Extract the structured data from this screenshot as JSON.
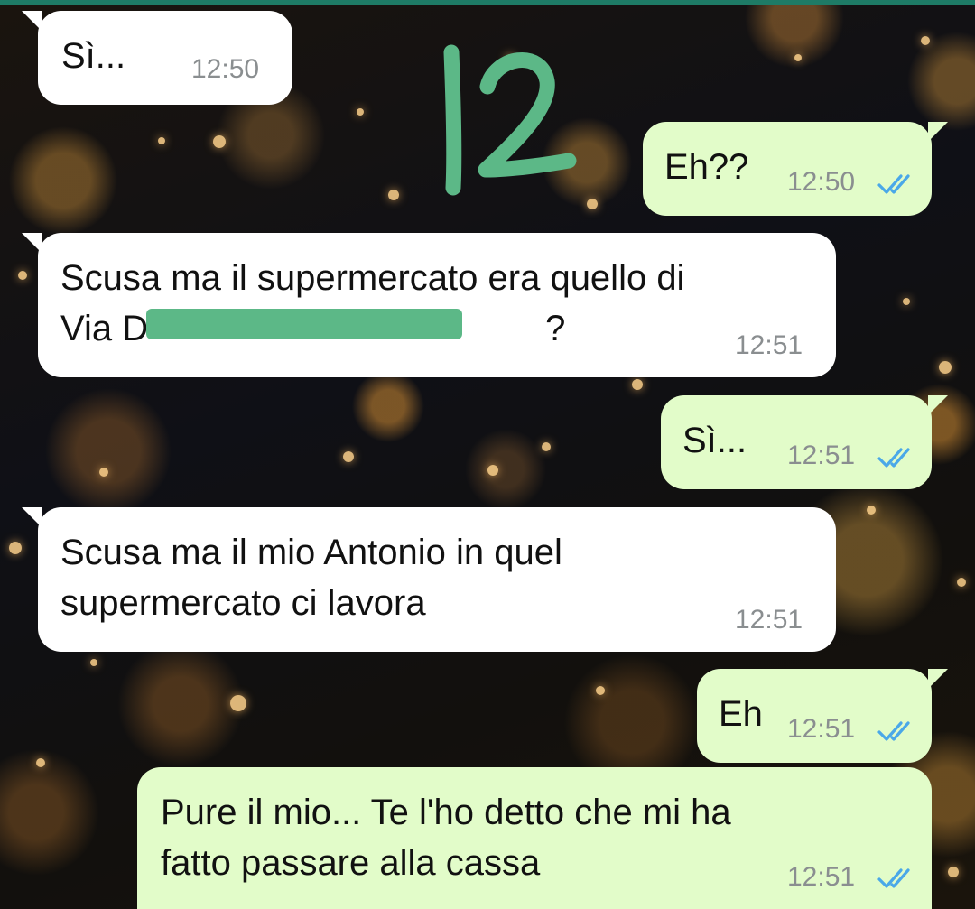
{
  "colors": {
    "incoming_bubble": "#ffffff",
    "outgoing_bubble": "#e2fcc9",
    "read_ticks": "#4aa8e8",
    "timestamp": "#8a8e90",
    "annotation": "#5cb887",
    "header_strip": "#1e7b66"
  },
  "annotation": {
    "label": "12"
  },
  "messages": [
    {
      "direction": "incoming",
      "text": "Sì...",
      "time": "12:50"
    },
    {
      "direction": "outgoing",
      "text": "Eh??",
      "time": "12:50",
      "status_icon": "double-check-read-icon"
    },
    {
      "direction": "incoming",
      "text": "Scusa ma il supermercato era quello di\nVia D           ?",
      "time": "12:51",
      "redacted": true
    },
    {
      "direction": "outgoing",
      "text": "Sì...",
      "time": "12:51",
      "status_icon": "double-check-read-icon"
    },
    {
      "direction": "incoming",
      "text": "Scusa ma il mio Antonio in quel\nsupermercato ci lavora",
      "time": "12:51"
    },
    {
      "direction": "outgoing",
      "text": "Eh",
      "time": "12:51",
      "status_icon": "double-check-read-icon"
    },
    {
      "direction": "outgoing",
      "text": "Pure il mio... Te l'ho detto che mi ha\nfatto passare alla cassa",
      "time": "12:51",
      "status_icon": "double-check-read-icon"
    }
  ]
}
